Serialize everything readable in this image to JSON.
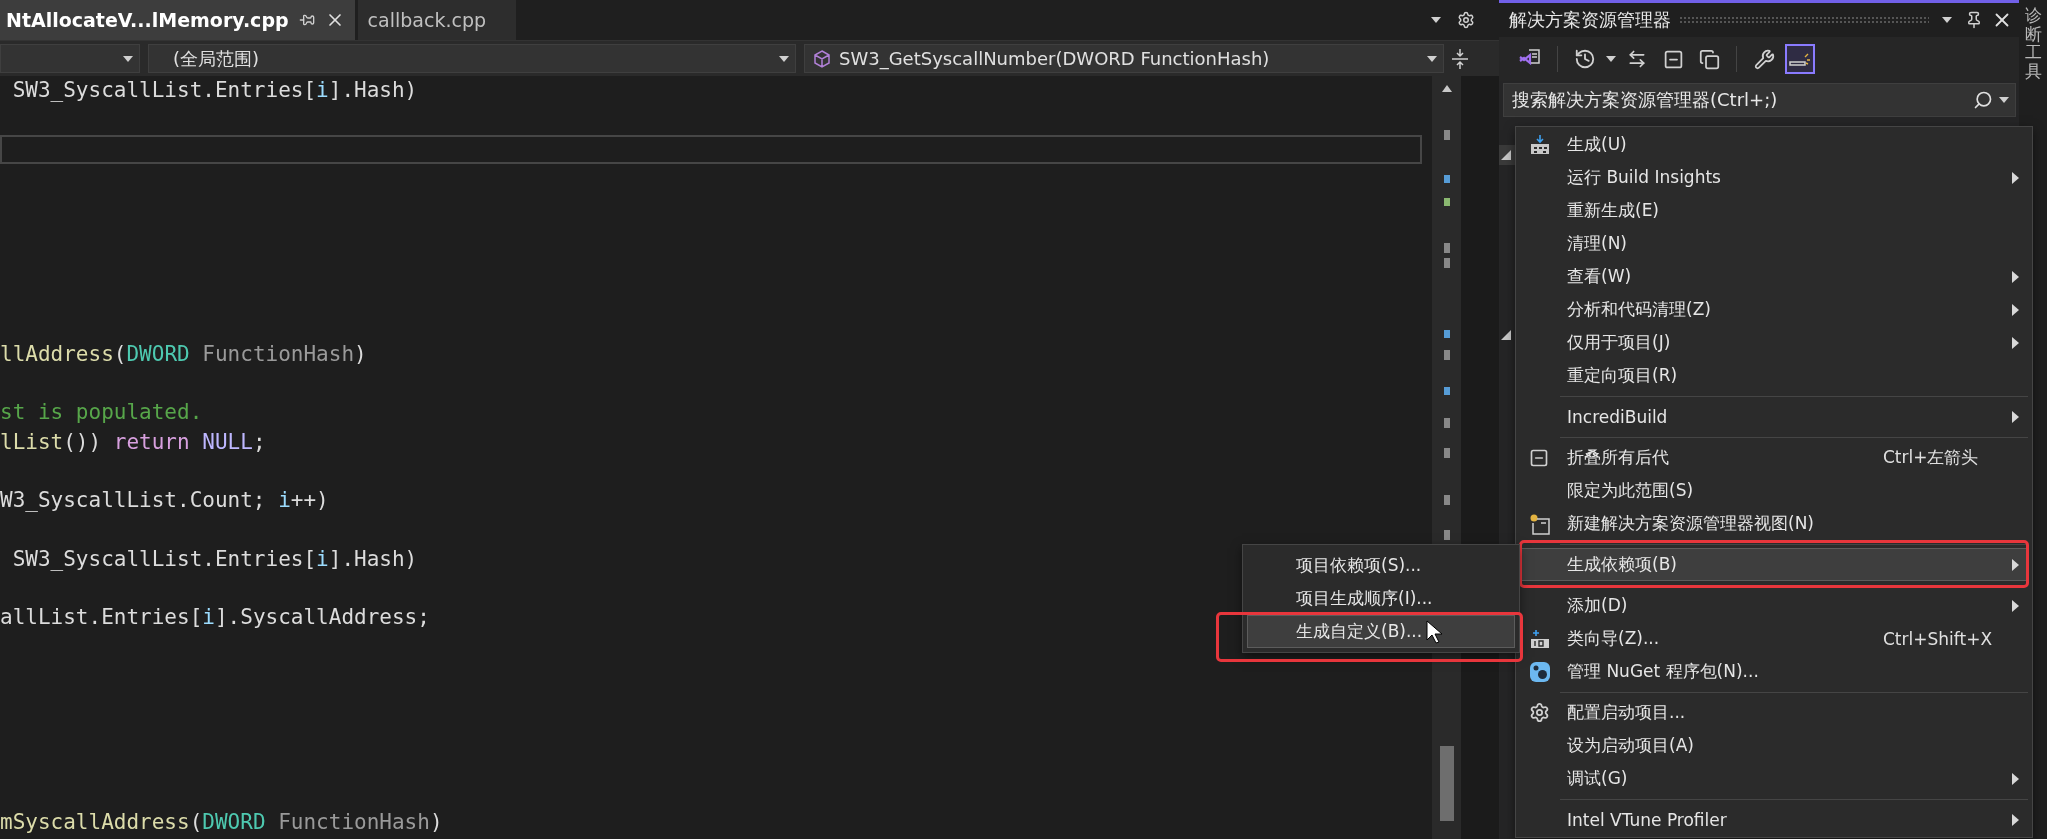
{
  "tabs": [
    {
      "label": "NtAllocateV...lMemory.cpp",
      "selected": true
    },
    {
      "label": "callback.cpp",
      "selected": false
    }
  ],
  "nav_bar": {
    "scope": "(全局范围)",
    "member": "SW3_GetSyscallNumber(DWORD FunctionHash)"
  },
  "code_lines": [
    {
      "kind": "code",
      "tokens": [
        {
          "text": " SW3_SyscallList.Entries[",
          "kind": "plain"
        },
        {
          "text": "i",
          "kind": "local"
        },
        {
          "text": "].Hash)",
          "kind": "plain"
        }
      ]
    },
    {
      "kind": "blank"
    },
    {
      "kind": "current"
    },
    {
      "kind": "blank"
    },
    {
      "kind": "blank"
    },
    {
      "kind": "blank"
    },
    {
      "kind": "blank"
    },
    {
      "kind": "blank"
    },
    {
      "kind": "blank"
    },
    {
      "kind": "code",
      "tokens": [
        {
          "text": "llAddress",
          "kind": "func"
        },
        {
          "text": "(",
          "kind": "plain"
        },
        {
          "text": "DWORD",
          "kind": "type"
        },
        {
          "text": " FunctionHash",
          "kind": "param"
        },
        {
          "text": ")",
          "kind": "plain"
        }
      ]
    },
    {
      "kind": "blank"
    },
    {
      "kind": "code",
      "tokens": [
        {
          "text": "st is populated.",
          "kind": "comment"
        }
      ]
    },
    {
      "kind": "code",
      "tokens": [
        {
          "text": "lList",
          "kind": "func"
        },
        {
          "text": "()) ",
          "kind": "plain"
        },
        {
          "text": "return ",
          "kind": "keyword"
        },
        {
          "text": "NULL",
          "kind": "macro"
        },
        {
          "text": ";",
          "kind": "plain"
        }
      ]
    },
    {
      "kind": "blank"
    },
    {
      "kind": "code",
      "tokens": [
        {
          "text": "W3_SyscallList.Count; ",
          "kind": "plain"
        },
        {
          "text": "i",
          "kind": "local"
        },
        {
          "text": "++)",
          "kind": "plain"
        }
      ]
    },
    {
      "kind": "blank"
    },
    {
      "kind": "code",
      "tokens": [
        {
          "text": " SW3_SyscallList.Entries[",
          "kind": "plain"
        },
        {
          "text": "i",
          "kind": "local"
        },
        {
          "text": "].Hash)",
          "kind": "plain"
        }
      ]
    },
    {
      "kind": "blank"
    },
    {
      "kind": "code",
      "tokens": [
        {
          "text": "allList.Entries[",
          "kind": "plain"
        },
        {
          "text": "i",
          "kind": "local"
        },
        {
          "text": "].SyscallAddress;",
          "kind": "plain"
        }
      ]
    },
    {
      "kind": "blank"
    },
    {
      "kind": "blank"
    },
    {
      "kind": "blank"
    },
    {
      "kind": "blank"
    },
    {
      "kind": "blank"
    },
    {
      "kind": "blank"
    },
    {
      "kind": "code",
      "tokens": [
        {
          "text": "mSyscallAddress",
          "kind": "func"
        },
        {
          "text": "(",
          "kind": "plain"
        },
        {
          "text": "DWORD",
          "kind": "type"
        },
        {
          "text": " FunctionHash",
          "kind": "param"
        },
        {
          "text": ")",
          "kind": "plain"
        }
      ]
    }
  ],
  "solution_explorer": {
    "title": "解决方案资源管理器",
    "toolbar": [
      [
        {
          "kind": "vs-home",
          "selected": false
        }
      ],
      [
        {
          "kind": "history",
          "selected": false
        },
        {
          "kind": "sync",
          "selected": false
        },
        {
          "kind": "collapse",
          "selected": false
        },
        {
          "kind": "multi",
          "selected": false
        }
      ],
      [
        {
          "kind": "properties",
          "selected": false
        },
        {
          "kind": "preview",
          "selected": true
        }
      ]
    ],
    "search": {
      "placeholder": "搜索解决方案资源管理器(Ctrl+;)"
    }
  },
  "side_strip": {
    "label": "诊断工具"
  },
  "context_menu": {
    "groups": [
      {
        "items": [
          {
            "label": "生成(U)",
            "kind": "build",
            "submenu": false,
            "selected": false,
            "outlined": false
          },
          {
            "label": "运行 Build Insights",
            "kind": "plain",
            "submenu": true,
            "selected": false,
            "outlined": false
          },
          {
            "label": "重新生成(E)",
            "kind": "plain",
            "submenu": false,
            "selected": false,
            "outlined": false
          },
          {
            "label": "清理(N)",
            "kind": "plain",
            "submenu": false,
            "selected": false,
            "outlined": false
          },
          {
            "label": "查看(W)",
            "kind": "plain",
            "submenu": true,
            "selected": false,
            "outlined": false
          },
          {
            "label": "分析和代码清理(Z)",
            "kind": "plain",
            "submenu": true,
            "selected": false,
            "outlined": false
          },
          {
            "label": "仅用于项目(J)",
            "kind": "plain",
            "submenu": true,
            "selected": false,
            "outlined": false
          },
          {
            "label": "重定向项目(R)",
            "kind": "plain",
            "submenu": false,
            "selected": false,
            "outlined": false
          }
        ]
      },
      {
        "items": [
          {
            "label": "IncrediBuild",
            "kind": "plain",
            "submenu": true,
            "selected": false,
            "outlined": false
          }
        ]
      },
      {
        "items": [
          {
            "label": "折叠所有后代",
            "kind": "collapse",
            "shortcut": "Ctrl+左箭头",
            "submenu": false,
            "selected": false,
            "outlined": false
          },
          {
            "label": "限定为此范围(S)",
            "kind": "plain",
            "submenu": false,
            "selected": false,
            "outlined": false
          },
          {
            "label": "新建解决方案资源管理器视图(N)",
            "kind": "new-view",
            "submenu": false,
            "selected": false,
            "outlined": false
          }
        ]
      },
      {
        "items": [
          {
            "label": "生成依赖项(B)",
            "kind": "plain",
            "submenu": true,
            "selected": true,
            "outlined": true
          }
        ]
      },
      {
        "items": [
          {
            "label": "添加(D)",
            "kind": "plain",
            "submenu": true,
            "selected": false,
            "outlined": false
          },
          {
            "label": "类向导(Z)...",
            "kind": "class-wizard",
            "shortcut": "Ctrl+Shift+X",
            "submenu": false,
            "selected": false,
            "outlined": false
          },
          {
            "label": "管理 NuGet 程序包(N)...",
            "kind": "nuget",
            "submenu": false,
            "selected": false,
            "outlined": false
          }
        ]
      },
      {
        "items": [
          {
            "label": "配置启动项目...",
            "kind": "configure",
            "submenu": false,
            "selected": false,
            "outlined": false
          },
          {
            "label": "设为启动项目(A)",
            "kind": "plain",
            "submenu": false,
            "selected": false,
            "outlined": false
          },
          {
            "label": "调试(G)",
            "kind": "plain",
            "submenu": true,
            "selected": false,
            "outlined": false
          }
        ]
      },
      {
        "items": [
          {
            "label": "Intel VTune Profiler",
            "kind": "plain",
            "submenu": true,
            "selected": false,
            "outlined": false
          }
        ]
      }
    ]
  },
  "submenu": {
    "items": [
      {
        "label": "项目依赖项(S)...",
        "selected": false,
        "outlined": false,
        "hovered": false
      },
      {
        "label": "项目生成顺序(I)...",
        "selected": false,
        "outlined": false,
        "hovered": false
      },
      {
        "label": "生成自定义(B)...",
        "selected": true,
        "outlined": true,
        "hovered": true
      }
    ]
  }
}
